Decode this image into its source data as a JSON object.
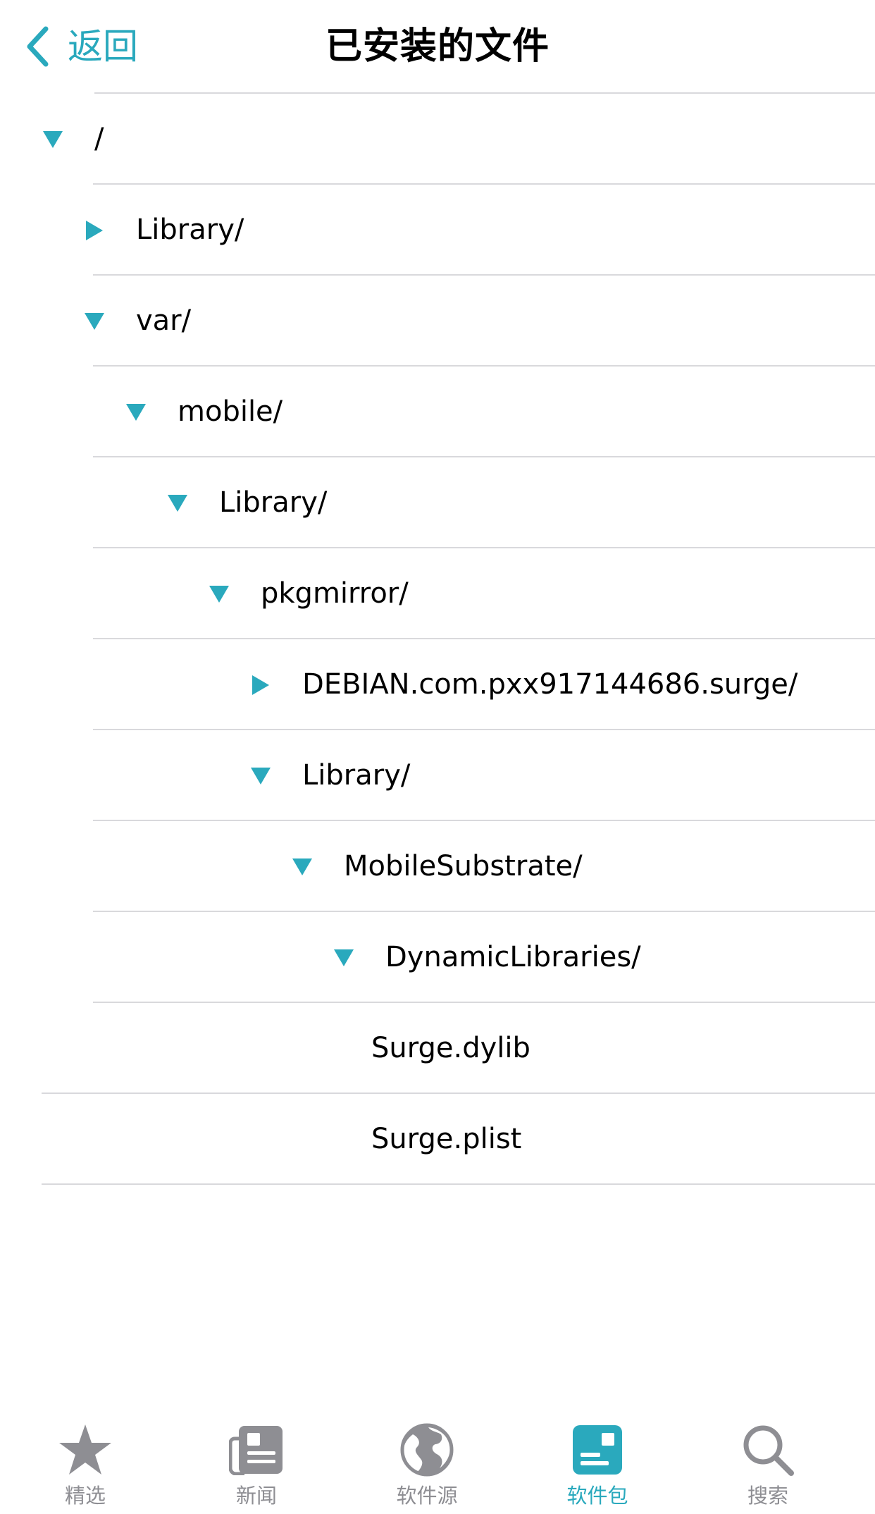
{
  "colors": {
    "accent": "#2aa9bd",
    "inactive": "#8e8e93",
    "separator": "#d9d9dc",
    "text": "#000000"
  },
  "nav": {
    "back_label": "返回",
    "title": "已安装的文件"
  },
  "tree": [
    {
      "label": "/",
      "toggle": "expanded",
      "level": 0,
      "icon": "triangle-down-icon"
    },
    {
      "label": "Library/",
      "toggle": "collapsed",
      "level": 1,
      "icon": "triangle-right-icon"
    },
    {
      "label": "var/",
      "toggle": "expanded",
      "level": 1,
      "icon": "triangle-down-icon"
    },
    {
      "label": "mobile/",
      "toggle": "expanded",
      "level": 2,
      "icon": "triangle-down-icon"
    },
    {
      "label": "Library/",
      "toggle": "expanded",
      "level": 3,
      "icon": "triangle-down-icon"
    },
    {
      "label": "pkgmirror/",
      "toggle": "expanded",
      "level": 4,
      "icon": "triangle-down-icon"
    },
    {
      "label": "DEBIAN.com.pxx917144686.surge/",
      "toggle": "collapsed",
      "level": 5,
      "icon": "triangle-right-icon"
    },
    {
      "label": "Library/",
      "toggle": "expanded",
      "level": 5,
      "icon": "triangle-down-icon"
    },
    {
      "label": "MobileSubstrate/",
      "toggle": "expanded",
      "level": 6,
      "icon": "triangle-down-icon"
    },
    {
      "label": "DynamicLibraries/",
      "toggle": "expanded",
      "level": 7,
      "icon": "triangle-down-icon"
    },
    {
      "label": "Surge.dylib",
      "toggle": "none",
      "level": 8,
      "icon": ""
    },
    {
      "label": "Surge.plist",
      "toggle": "none",
      "level": 8,
      "icon": ""
    }
  ],
  "tabs": [
    {
      "label": "精选",
      "icon": "star-icon",
      "active": false
    },
    {
      "label": "新闻",
      "icon": "newspaper-icon",
      "active": false
    },
    {
      "label": "软件源",
      "icon": "globe-icon",
      "active": false
    },
    {
      "label": "软件包",
      "icon": "package-icon",
      "active": true
    },
    {
      "label": "搜索",
      "icon": "search-icon",
      "active": false
    }
  ]
}
